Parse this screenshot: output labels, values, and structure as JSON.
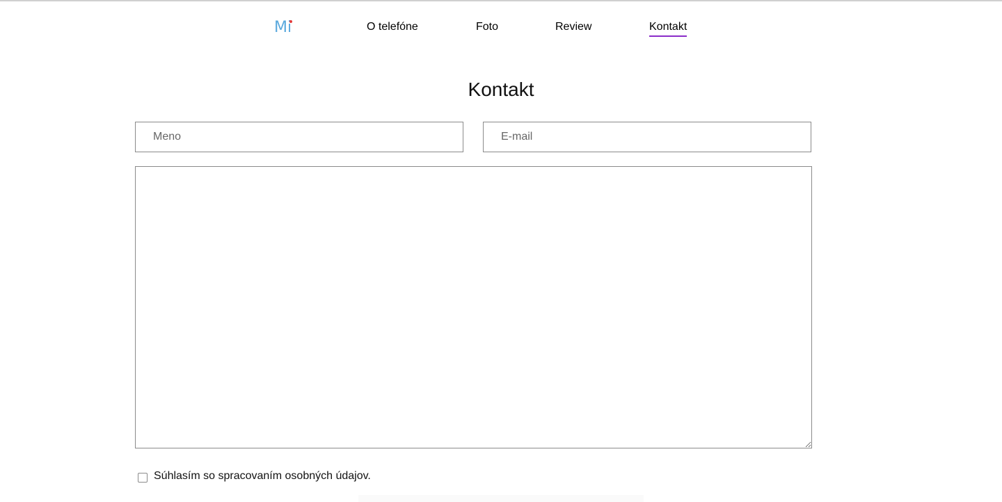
{
  "nav": {
    "logo_text": "Mi",
    "links": [
      {
        "label": "O telefóne"
      },
      {
        "label": "Foto"
      },
      {
        "label": "Review"
      },
      {
        "label": "Kontakt",
        "active": true
      }
    ],
    "active_underline_color": "#8a2bc8",
    "logo_color": "#5aa9dd",
    "logo_dot_color": "#e23b3b"
  },
  "contact": {
    "title": "Kontakt",
    "name_placeholder": "Meno",
    "email_placeholder": "E-mail",
    "message_value": "",
    "consent_label": "Súhlasím so spracovaním osobných údajov.",
    "consent_checked": false
  }
}
